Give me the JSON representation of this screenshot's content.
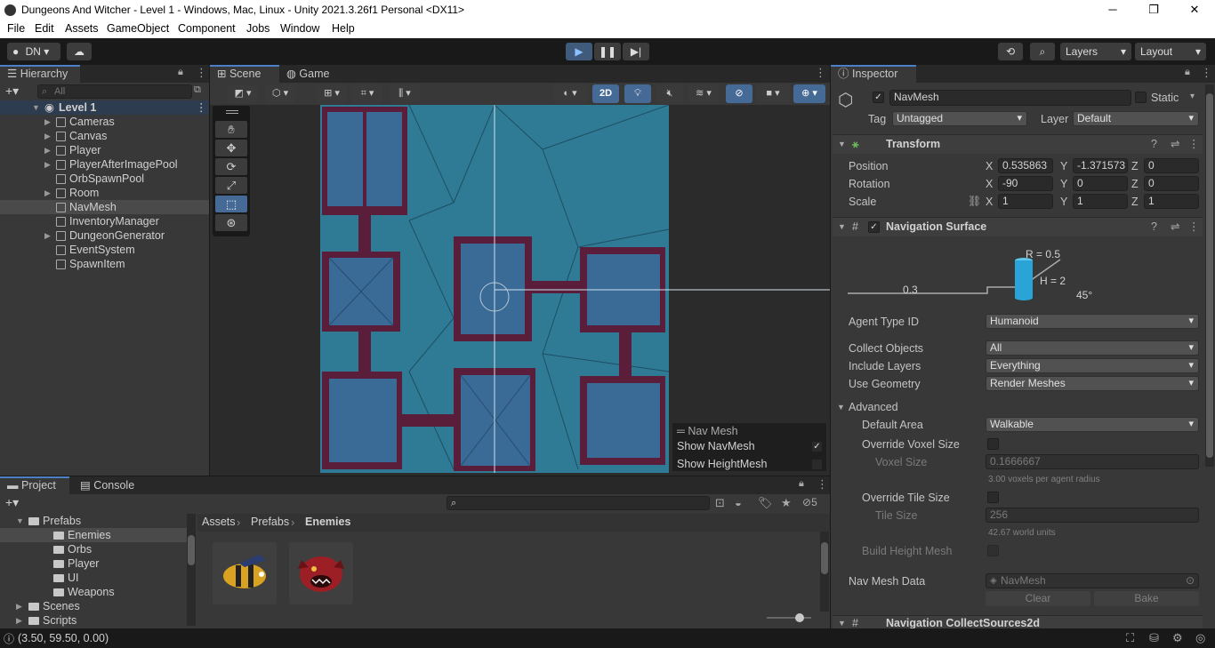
{
  "window": {
    "title": "Dungeons And Witcher - Level 1 - Windows, Mac, Linux - Unity 2021.3.26f1 Personal <DX11>",
    "minimize": "─",
    "maximize": "❐",
    "close": "✕"
  },
  "menu": [
    "File",
    "Edit",
    "Assets",
    "GameObject",
    "Component",
    "Jobs",
    "Window",
    "Help"
  ],
  "toolbar": {
    "account": "DN",
    "layers": "Layers",
    "layout": "Layout"
  },
  "hierarchy": {
    "tab": "Hierarchy",
    "search_placeholder": "All",
    "scene": "Level 1",
    "items": [
      {
        "label": "Cameras",
        "expandable": true
      },
      {
        "label": "Canvas",
        "expandable": true
      },
      {
        "label": "Player",
        "expandable": true
      },
      {
        "label": "PlayerAfterImagePool",
        "expandable": true
      },
      {
        "label": "OrbSpawnPool",
        "expandable": false
      },
      {
        "label": "Room",
        "expandable": true
      },
      {
        "label": "NavMesh",
        "expandable": false,
        "selected": true
      },
      {
        "label": "InventoryManager",
        "expandable": false
      },
      {
        "label": "DungeonGenerator",
        "expandable": true
      },
      {
        "label": "EventSystem",
        "expandable": false
      },
      {
        "label": "SpawnItem",
        "expandable": false
      }
    ]
  },
  "scene": {
    "tab_scene": "Scene",
    "tab_game": "Game",
    "mode_2d": "2D",
    "overlay": {
      "title": "Nav Mesh",
      "show_navmesh": "Show NavMesh",
      "show_heightmesh": "Show HeightMesh"
    }
  },
  "inspector": {
    "tab": "Inspector",
    "name": "NavMesh",
    "static": "Static",
    "tag_label": "Tag",
    "tag": "Untagged",
    "layer_label": "Layer",
    "layer": "Default",
    "transform": {
      "title": "Transform",
      "position_label": "Position",
      "rotation_label": "Rotation",
      "scale_label": "Scale",
      "position": {
        "x": "0.535863",
        "y": "-1.371573",
        "z": "0"
      },
      "rotation": {
        "x": "-90",
        "y": "0",
        "z": "0"
      },
      "scale": {
        "x": "1",
        "y": "1",
        "z": "1"
      }
    },
    "nav_surface": {
      "title": "Navigation Surface",
      "diagram": {
        "r": "R = 0.5",
        "h": "H = 2",
        "step": "0.3",
        "slope": "45°"
      },
      "agent_type_label": "Agent Type ID",
      "agent_type": "Humanoid",
      "collect_objects_label": "Collect Objects",
      "collect_objects": "All",
      "include_layers_label": "Include Layers",
      "include_layers": "Everything",
      "use_geometry_label": "Use Geometry",
      "use_geometry": "Render Meshes",
      "advanced_label": "Advanced",
      "default_area_label": "Default Area",
      "default_area": "Walkable",
      "override_voxel_label": "Override Voxel Size",
      "voxel_size_label": "Voxel Size",
      "voxel_size": "0.1666667",
      "voxel_hint": "3.00 voxels per agent radius",
      "override_tile_label": "Override Tile Size",
      "tile_size_label": "Tile Size",
      "tile_size": "256",
      "tile_hint": "42.67 world units",
      "build_height_label": "Build Height Mesh",
      "nav_data_label": "Nav Mesh Data",
      "nav_data": "NavMesh",
      "clear": "Clear",
      "bake": "Bake"
    },
    "next_component": "Navigation CollectSources2d"
  },
  "project": {
    "tab_project": "Project",
    "tab_console": "Console",
    "hidden_count": "5",
    "tree": [
      {
        "label": "Prefabs",
        "level": 1
      },
      {
        "label": "Enemies",
        "level": 2,
        "selected": true
      },
      {
        "label": "Orbs",
        "level": 2
      },
      {
        "label": "Player",
        "level": 2
      },
      {
        "label": "UI",
        "level": 2
      },
      {
        "label": "Weapons",
        "level": 2
      },
      {
        "label": "Scenes",
        "level": 1
      },
      {
        "label": "Scripts",
        "level": 1
      }
    ],
    "breadcrumb": [
      "Assets",
      "Prefabs",
      "Enemies"
    ]
  },
  "status": {
    "coords": "(3.50, 59.50, 0.00)"
  },
  "colors": {
    "accent": "#4d7fc4",
    "navmesh": "#2f7a94",
    "wall": "#5a1d3a",
    "room": "#3a6a96"
  }
}
